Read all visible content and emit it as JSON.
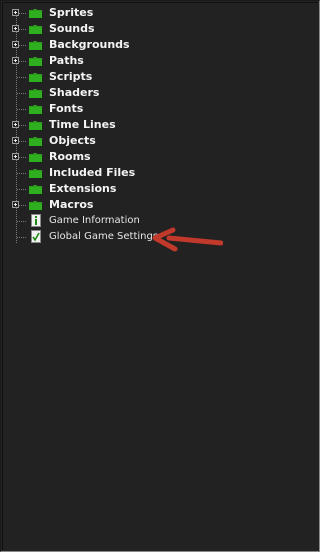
{
  "tree": {
    "items": [
      {
        "label": "Sprites",
        "type": "folder",
        "expandable": true
      },
      {
        "label": "Sounds",
        "type": "folder",
        "expandable": true
      },
      {
        "label": "Backgrounds",
        "type": "folder",
        "expandable": true
      },
      {
        "label": "Paths",
        "type": "folder",
        "expandable": true
      },
      {
        "label": "Scripts",
        "type": "folder",
        "expandable": false
      },
      {
        "label": "Shaders",
        "type": "folder",
        "expandable": false
      },
      {
        "label": "Fonts",
        "type": "folder",
        "expandable": false
      },
      {
        "label": "Time Lines",
        "type": "folder",
        "expandable": true
      },
      {
        "label": "Objects",
        "type": "folder",
        "expandable": true
      },
      {
        "label": "Rooms",
        "type": "folder",
        "expandable": true
      },
      {
        "label": "Included Files",
        "type": "folder",
        "expandable": false
      },
      {
        "label": "Extensions",
        "type": "folder",
        "expandable": false
      },
      {
        "label": "Macros",
        "type": "folder",
        "expandable": true
      },
      {
        "label": "Game Information",
        "type": "info",
        "expandable": false
      },
      {
        "label": "Global Game Settings",
        "type": "settings",
        "expandable": false
      }
    ]
  },
  "annotation": {
    "icon": "red-arrow-icon",
    "color": "#c0392b"
  },
  "colors": {
    "folder": "#2e9a1e",
    "background": "#222222",
    "text": "#f4f4f4"
  }
}
